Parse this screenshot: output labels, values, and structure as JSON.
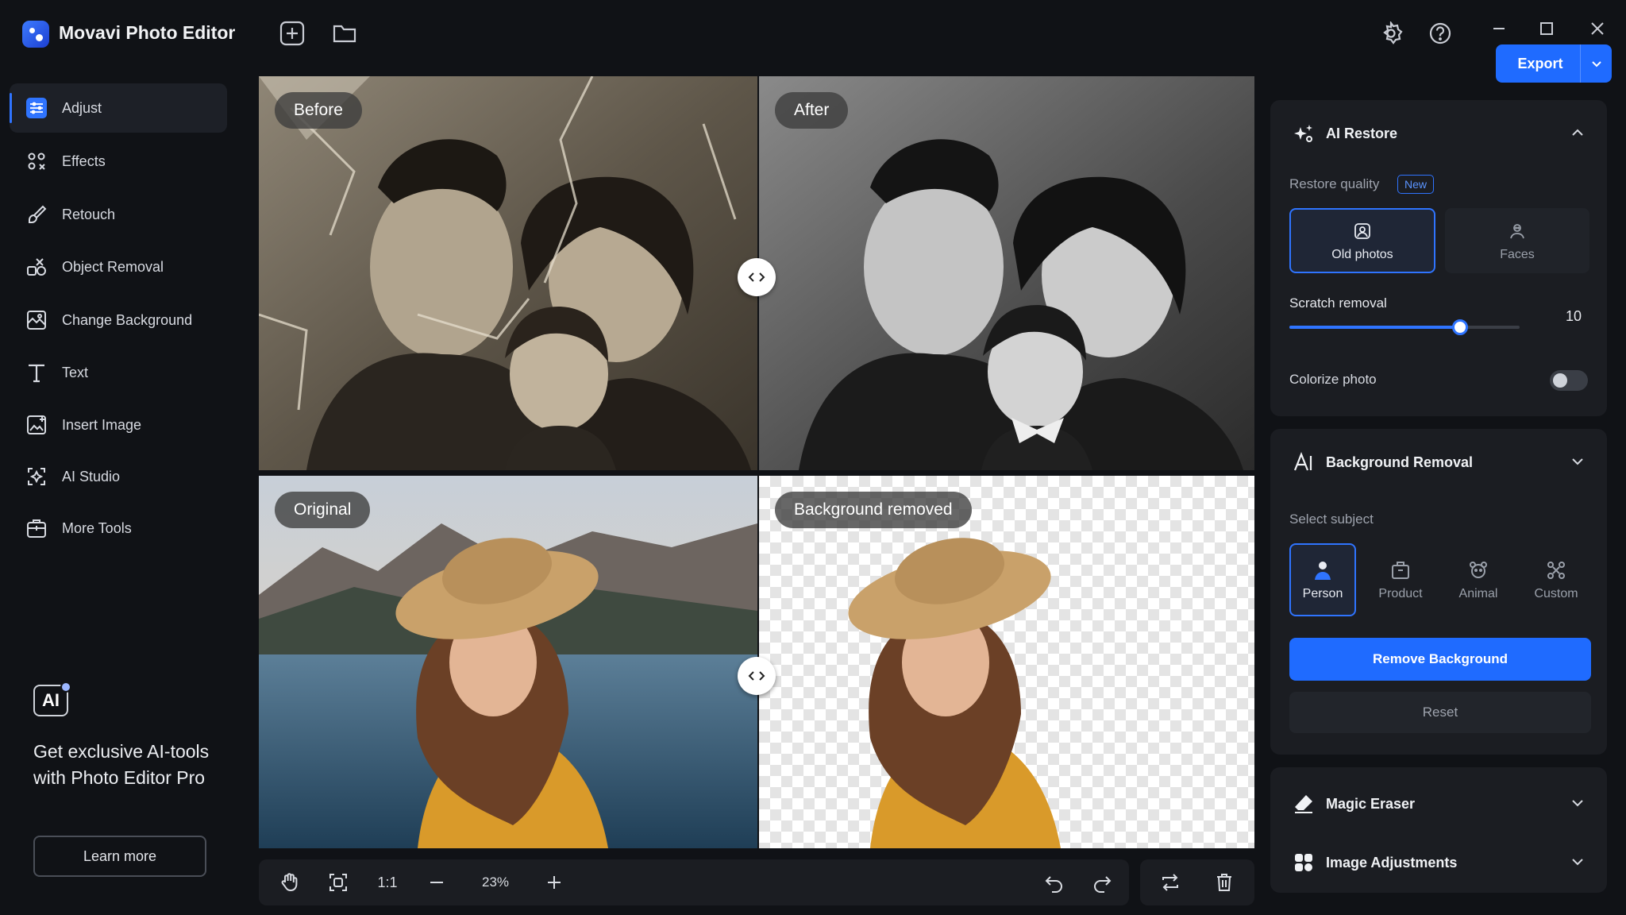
{
  "app": {
    "title": "Movavi Photo Editor"
  },
  "export": {
    "label": "Export"
  },
  "sidebar": {
    "items": [
      {
        "label": "Adjust",
        "icon": "sliders-icon"
      },
      {
        "label": "Effects",
        "icon": "effects-icon"
      },
      {
        "label": "Retouch",
        "icon": "brush-icon"
      },
      {
        "label": "Object Removal",
        "icon": "object-removal-icon"
      },
      {
        "label": "Change Background",
        "icon": "background-icon"
      },
      {
        "label": "Text",
        "icon": "text-icon"
      },
      {
        "label": "Insert Image",
        "icon": "insert-image-icon"
      },
      {
        "label": "AI Studio",
        "icon": "ai-studio-icon"
      },
      {
        "label": "More Tools",
        "icon": "more-tools-icon"
      }
    ],
    "promo": {
      "badge": "AI",
      "text": "Get exclusive AI-tools with Photo Editor Pro",
      "button": "Learn more"
    }
  },
  "canvas": {
    "labels": {
      "before": "Before",
      "after": "After",
      "original": "Original",
      "bg_removed": "Background removed"
    },
    "toolbar": {
      "ratio": "1:1",
      "zoom": "23%"
    }
  },
  "panel": {
    "ai_restore": {
      "title": "AI Restore",
      "quality_label": "Restore quality",
      "new_badge": "New",
      "options": [
        {
          "label": "Old photos",
          "selected": true
        },
        {
          "label": "Faces",
          "selected": false
        }
      ],
      "scratch_label": "Scratch removal",
      "scratch_value": "10",
      "scratch_fraction": 0.74,
      "colorize_label": "Colorize photo",
      "colorize_on": false
    },
    "bg_removal": {
      "title": "Background Removal",
      "subject_label": "Select subject",
      "subjects": [
        {
          "label": "Person",
          "selected": true
        },
        {
          "label": "Product",
          "selected": false
        },
        {
          "label": "Animal",
          "selected": false
        },
        {
          "label": "Custom",
          "selected": false
        }
      ],
      "remove_button": "Remove Background",
      "reset_button": "Reset"
    },
    "magic_eraser": {
      "title": "Magic Eraser"
    },
    "image_adjustments": {
      "title": "Image Adjustments"
    }
  },
  "colors": {
    "accent": "#1f6bff",
    "panel": "#1b1d22",
    "bg": "#101216"
  }
}
